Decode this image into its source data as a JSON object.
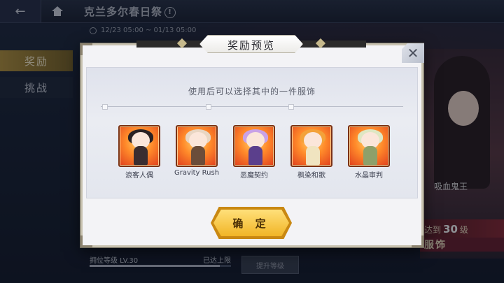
{
  "background": {
    "event_title": "克兰多尔春日祭",
    "event_title_info": "!",
    "event_time": "12/23 05:00 ~ 01/13 05:00",
    "side_tabs": [
      {
        "label": "奖励"
      },
      {
        "label": "挑战"
      }
    ],
    "bottom": {
      "level": "拥位等级 LV.30",
      "max": "已达上限",
      "progress": 0.92,
      "upgrade_label": "提升等级"
    },
    "art": {
      "level_prefix": "达到",
      "level_value": "30",
      "level_suffix": "级",
      "costume_label": "服饰",
      "tag": "吸血鬼王"
    }
  },
  "dialog": {
    "title": "奖励预览",
    "close_glyph": "✕",
    "hint": "使用后可以选择其中的一件服饰",
    "items": [
      {
        "label": "浪客人偶",
        "hair": "#2a2224",
        "outfit": "#3a2d30"
      },
      {
        "label": "Gravity  Rush",
        "hair": "#e9d6c3",
        "outfit": "#6b4d3a"
      },
      {
        "label": "恶魔契约",
        "hair": "#c9a2e6",
        "outfit": "#5b3f8c"
      },
      {
        "label": "枫染和歌",
        "hair": "#f3a23a",
        "outfit": "#f0e4c0"
      },
      {
        "label": "水晶审判",
        "hair": "#dfe7c3",
        "outfit": "#8da06a"
      }
    ],
    "confirm_label": "确 定"
  }
}
